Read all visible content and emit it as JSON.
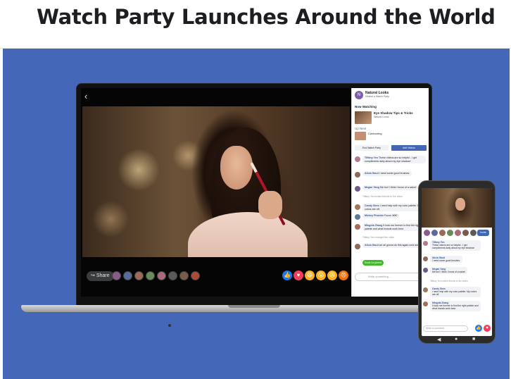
{
  "headline": "Watch Party Launches Around the World",
  "laptop": {
    "back_icon": "‹",
    "share_label": "Share",
    "viewer_colors": [
      "#8a5a8a",
      "#5a6a9a",
      "#9a6a5a",
      "#6a8a5a",
      "#aa6a7a",
      "#5a5a5a",
      "#7a5a4a",
      "#aa4a3a"
    ],
    "reactions": [
      {
        "name": "like",
        "glyph": "👍",
        "color": "#1877f2"
      },
      {
        "name": "love",
        "glyph": "♥",
        "color": "#f33e58"
      },
      {
        "name": "haha",
        "glyph": "😆",
        "color": "#f7b125"
      },
      {
        "name": "wow",
        "glyph": "😮",
        "color": "#f7b125"
      },
      {
        "name": "sad",
        "glyph": "😢",
        "color": "#f7b125"
      },
      {
        "name": "angry",
        "glyph": "😠",
        "color": "#e9710f"
      }
    ],
    "panel": {
      "page_initial": "N",
      "page_name": "Natural Looks",
      "page_sub": "Hosted a Watch Party",
      "now_watching_label": "Now Watching",
      "now_title": "Eye Shadow Tips & Tricks",
      "now_sub": "Natural Looks",
      "up_next_label": "Up Next",
      "up_title": "Contouring",
      "end_button": "End Watch Party",
      "add_button": "Add Videos",
      "comments": [
        {
          "name": "Tiffany Yen",
          "text": "These videos are so helpful - I get compliments daily about my eye shadow!",
          "color": "#b07a90"
        },
        {
          "name": "Alicia Stout",
          "text": "I need some good brushes.",
          "color": "#8a6a5a"
        },
        {
          "name": "Megan Yang",
          "text": "Me too! I think I know of a salon!",
          "color": "#6a5a8a"
        },
        {
          "name": "Candy Sims",
          "text": "I need help with my color palette. My colors are off.",
          "color": "#9a7a5a"
        },
        {
          "name": "Mickey Phoenix",
          "text": "Focus 4l0l0",
          "color": "#5a7a9a"
        },
        {
          "name": "Mingola Zhang",
          "text": "It took me forever to find the right palette and what brands work best.",
          "color": "#aa6a5a"
        },
        {
          "name": "Alicia Stout",
          "text": "we all gonna do this again next week!?",
          "color": "#8a6a5a"
        }
      ],
      "joined_text": "Tiffany Yen invited friends to the video",
      "joined_text_2": "Tiffany Yen changed the video",
      "join_pill": "Scott Lin joined",
      "comment_placeholder": "Write something..."
    }
  },
  "phone": {
    "viewer_colors": [
      "#8a5a8a",
      "#5a6a9a",
      "#9a6a5a",
      "#6a8a5a",
      "#aa6a7a",
      "#7a5a4a",
      "#5a5a5a"
    ],
    "invite_label": "Invite",
    "comments": [
      {
        "name": "Tiffany Yen",
        "text": "These videos are so helpful - I get compliments daily about my eye shadow!",
        "color": "#b07a90"
      },
      {
        "name": "Alicia Stout",
        "text": "I need some good brushes.",
        "color": "#8a6a5a"
      },
      {
        "name": "Megan Yang",
        "text": "Me too! I think I know of a salon!",
        "color": "#6a5a8a"
      },
      {
        "name": "Candy Sims",
        "text": "I need help with my color palette. My colors are off.",
        "color": "#9a7a5a"
      },
      {
        "name": "Mingola Zhang",
        "text": "It took me forever to find the right palette and what brands work best.",
        "color": "#aa6a5a"
      }
    ],
    "joined_text": "Tiffany Yen invited friends to the video",
    "comment_placeholder": "Write a comment...",
    "nav_back": "◀",
    "nav_home": "●",
    "nav_recent": "■"
  },
  "colors": {
    "stage": "#4467b8",
    "accent": "#4267b2",
    "green": "#42b72a"
  }
}
